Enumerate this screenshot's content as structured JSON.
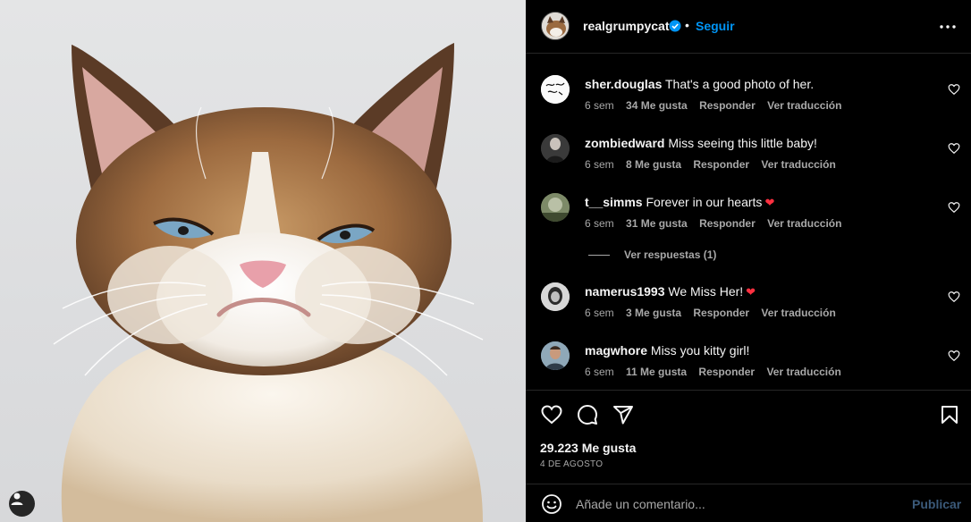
{
  "post": {
    "author": "realgrumpycat",
    "follow_label": "Seguir",
    "separator": "•",
    "image_subject": "grumpy-cat-photo"
  },
  "comments": [
    {
      "user": "sher.douglas",
      "text": "That's a good photo of her.",
      "time": "6 sem",
      "likes": "34 Me gusta",
      "reply": "Responder",
      "translate": "Ver traducción",
      "emoji": ""
    },
    {
      "user": "zombiedward",
      "text": "Miss seeing this little baby!",
      "time": "6 sem",
      "likes": "8 Me gusta",
      "reply": "Responder",
      "translate": "Ver traducción",
      "emoji": ""
    },
    {
      "user": "t__simms",
      "text": "Forever in our hearts",
      "time": "6 sem",
      "likes": "31 Me gusta",
      "reply": "Responder",
      "translate": "Ver traducción",
      "emoji": "❤"
    },
    {
      "user": "namerus1993",
      "text": "We Miss Her!",
      "time": "6 sem",
      "likes": "3 Me gusta",
      "reply": "Responder",
      "translate": "Ver traducción",
      "emoji": "❤"
    },
    {
      "user": "magwhore",
      "text": "Miss you kitty girl!",
      "time": "6 sem",
      "likes": "11 Me gusta",
      "reply": "Responder",
      "translate": "Ver traducción",
      "emoji": ""
    }
  ],
  "view_replies": "Ver respuestas (1)",
  "stats": {
    "likes": "29.223 Me gusta",
    "date": "4 DE AGOSTO"
  },
  "composer": {
    "placeholder": "Añade un comentario...",
    "publish_label": "Publicar"
  },
  "colors": {
    "accent": "#0095f6",
    "background": "#000000",
    "heart_red": "#ff3040",
    "muted_text": "#a8a8a8"
  }
}
